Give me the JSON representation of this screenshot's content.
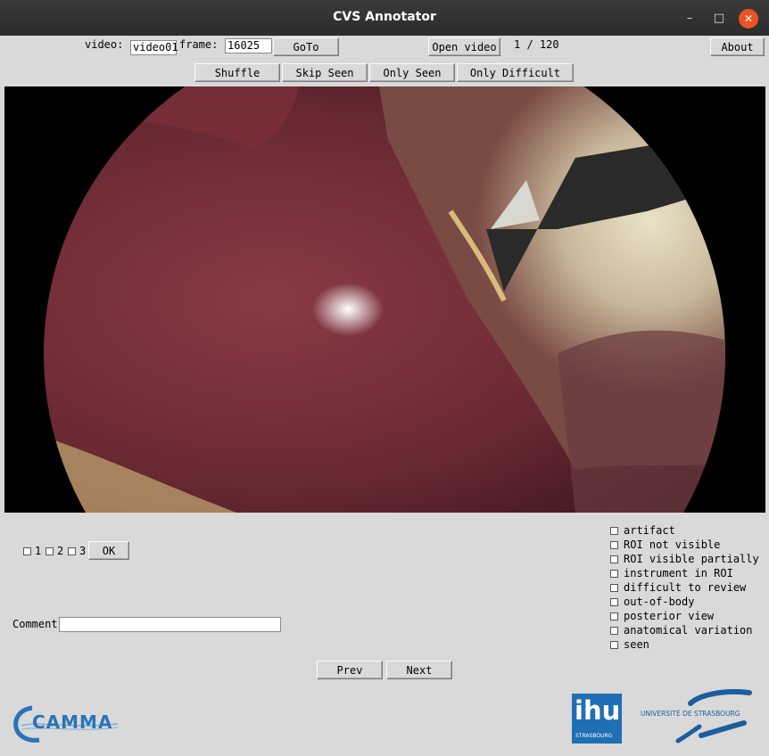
{
  "window": {
    "title": "CVS Annotator",
    "minimize": "–",
    "maximize": "□",
    "close": "✕"
  },
  "toolbar": {
    "video_label": "video:",
    "video_value": "video01",
    "frame_label": "frame:",
    "frame_value": "16025",
    "goto": "GoTo",
    "open_video": "Open video",
    "counter": "1 / 120",
    "about": "About",
    "shuffle": "Shuffle",
    "skip_seen": "Skip Seen",
    "only_seen": "Only Seen",
    "only_difficult": "Only Difficult"
  },
  "criteria": {
    "items": [
      {
        "label": "1"
      },
      {
        "label": "2"
      },
      {
        "label": "3"
      }
    ],
    "ok": "OK"
  },
  "comment": {
    "label": "Comment",
    "value": ""
  },
  "flags": {
    "items": [
      {
        "label": "artifact"
      },
      {
        "label": "ROI not visible"
      },
      {
        "label": "ROI visible partially"
      },
      {
        "label": "instrument in ROI"
      },
      {
        "label": "difficult to review"
      },
      {
        "label": "out-of-body"
      },
      {
        "label": "posterior view"
      },
      {
        "label": "anatomical variation"
      },
      {
        "label": "seen"
      }
    ]
  },
  "nav": {
    "prev": "Prev",
    "next": "Next"
  },
  "logos": {
    "camma": "CAMMA",
    "ihu": "ihu",
    "ihu_sub": "STRASBOURG",
    "unistra": "UNIVERSITÉ DE STRASBOURG"
  },
  "colors": {
    "ihu_blue": "#1f6fb5",
    "camma_blue": "#2a73b8",
    "unistra_blue": "#1b5e9e"
  }
}
